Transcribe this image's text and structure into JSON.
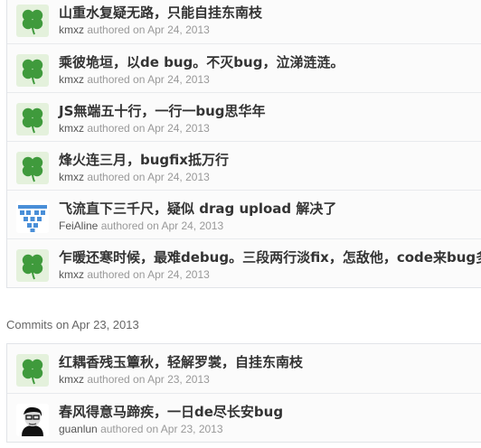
{
  "groups": [
    {
      "commits": [
        {
          "message": "山重水复疑无路，只能自挂东南枝",
          "author": "kmxz",
          "verb": "authored on",
          "date": "Apr 24, 2013",
          "avatar": "clover-avatar"
        },
        {
          "message": "乘彼垝垣，以de bug。不灭bug，泣涕涟涟。",
          "author": "kmxz",
          "verb": "authored on",
          "date": "Apr 24, 2013",
          "avatar": "clover-avatar"
        },
        {
          "message": "JS無端五十行，一行一bug思华年",
          "author": "kmxz",
          "verb": "authored on",
          "date": "Apr 24, 2013",
          "avatar": "clover-avatar"
        },
        {
          "message": "烽火连三月，bugfix抵万行",
          "author": "kmxz",
          "verb": "authored on",
          "date": "Apr 24, 2013",
          "avatar": "clover-avatar"
        },
        {
          "message": "飞流直下三千尺，疑似 drag upload 解决了",
          "author": "FeiAline",
          "verb": "authored on",
          "date": "Apr 24, 2013",
          "avatar": "identicon-avatar"
        },
        {
          "message": "乍暖还寒时候，最难debug。三段两行淡fix，怎敌他，code来bug多！",
          "author": "kmxz",
          "verb": "authored on",
          "date": "Apr 24, 2013",
          "avatar": "clover-avatar"
        }
      ]
    },
    {
      "heading_prefix": "Commits on",
      "heading_date": "Apr 23, 2013",
      "commits": [
        {
          "message": "红耦香残玉簟秋，轻解罗裳，自挂东南枝",
          "author": "kmxz",
          "verb": "authored on",
          "date": "Apr 23, 2013",
          "avatar": "clover-avatar"
        },
        {
          "message": "春风得意马蹄疾，一日de尽长安bug",
          "author": "guanlun",
          "verb": "authored on",
          "date": "Apr 23, 2013",
          "avatar": "photo-avatar"
        }
      ]
    }
  ],
  "colors": {
    "clover": "#3e9b3e",
    "clover_bg": "#d9ecd0",
    "identicon": "#4a8fd8",
    "title": "#333333",
    "meta": "#999999"
  }
}
